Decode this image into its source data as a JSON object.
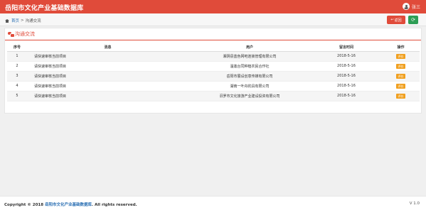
{
  "header": {
    "app_title": "岳阳市文化产业基础数据库",
    "user_name": "张三",
    "user_icon": "user-avatar-icon",
    "brand_color": "#e04b3a"
  },
  "breadcrumb": {
    "home_label": "首页",
    "separator": ">",
    "current": "沟通交流"
  },
  "toolbar": {
    "back_label": "返回",
    "back_icon": "reply-arrow-icon",
    "refresh_icon": "refresh-icon",
    "back_color": "#e04b3a",
    "refresh_color": "#2e9e55"
  },
  "panel": {
    "title": "沟通交流",
    "icon": "chat-bubbles-icon"
  },
  "table": {
    "headers": [
      "序号",
      "消息",
      "用户",
      "留言时间",
      "操作"
    ],
    "rows": [
      {
        "no": "1",
        "message": "请快速审核当前项目",
        "user": "湘阴县蓝色网吧连锁管理有限公司",
        "time": "2018-5-16",
        "action": "评价"
      },
      {
        "no": "2",
        "message": "请快速审核当前项目",
        "user": "温莲台同种植农民合作社",
        "time": "2018-5-16",
        "action": "评价"
      },
      {
        "no": "3",
        "message": "请快速审核当前项目",
        "user": "岳阳市展设创意传媒有限公司",
        "time": "2018-5-16",
        "action": "评价"
      },
      {
        "no": "4",
        "message": "请快速审核当前项目",
        "user": "湖南一叶舟豹具有限公司",
        "time": "2018-5-16",
        "action": "评价"
      },
      {
        "no": "5",
        "message": "请快速审核当前项目",
        "user": "汨罗市文化旅游产业建设投资有限公司",
        "time": "2018-5-16",
        "action": "评价"
      }
    ],
    "action_color": "#f0a020"
  },
  "footer": {
    "copyright_prefix": "Copyright © 2018",
    "copyright_link": "岳阳市文化产业基础数据库",
    "copyright_suffix": ". All rights reserved.",
    "version": "V 1.0"
  }
}
